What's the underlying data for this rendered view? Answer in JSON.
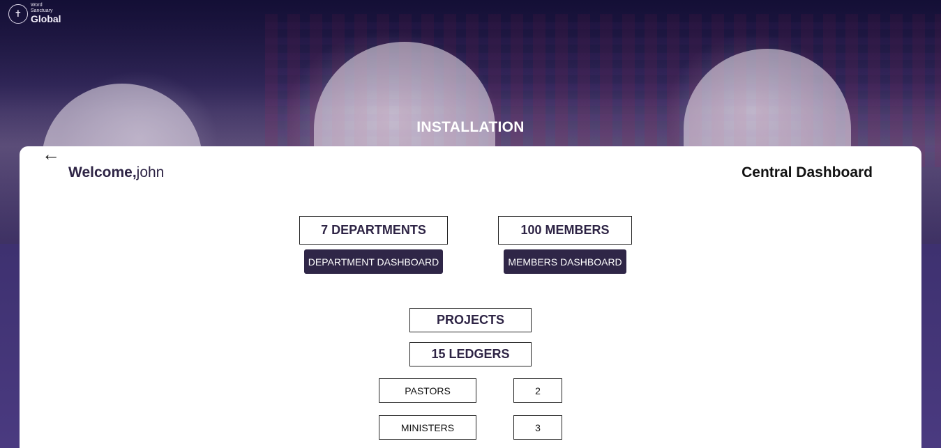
{
  "logo": {
    "line1": "Word",
    "line2": "Sanctuary",
    "line3": "Global"
  },
  "hero": {
    "title": "INSTALLATION"
  },
  "card": {
    "welcome_label": "Welcome,",
    "user_name": "john",
    "dashboard_title": "Central Dashboard"
  },
  "stats": {
    "departments": "7 DEPARTMENTS",
    "members": "100 MEMBERS",
    "projects": "PROJECTS",
    "ledgers": "15 LEDGERS"
  },
  "buttons": {
    "department_dashboard": "DEPARTMENT DASHBOARD",
    "members_dashboard": "MEMBERS DASHBOARD"
  },
  "roles": [
    {
      "label": "PASTORS",
      "count": "2"
    },
    {
      "label": "MINISTERS",
      "count": "3"
    }
  ],
  "colors": {
    "accent": "#2f2647",
    "text_dark": "#2e2445"
  }
}
